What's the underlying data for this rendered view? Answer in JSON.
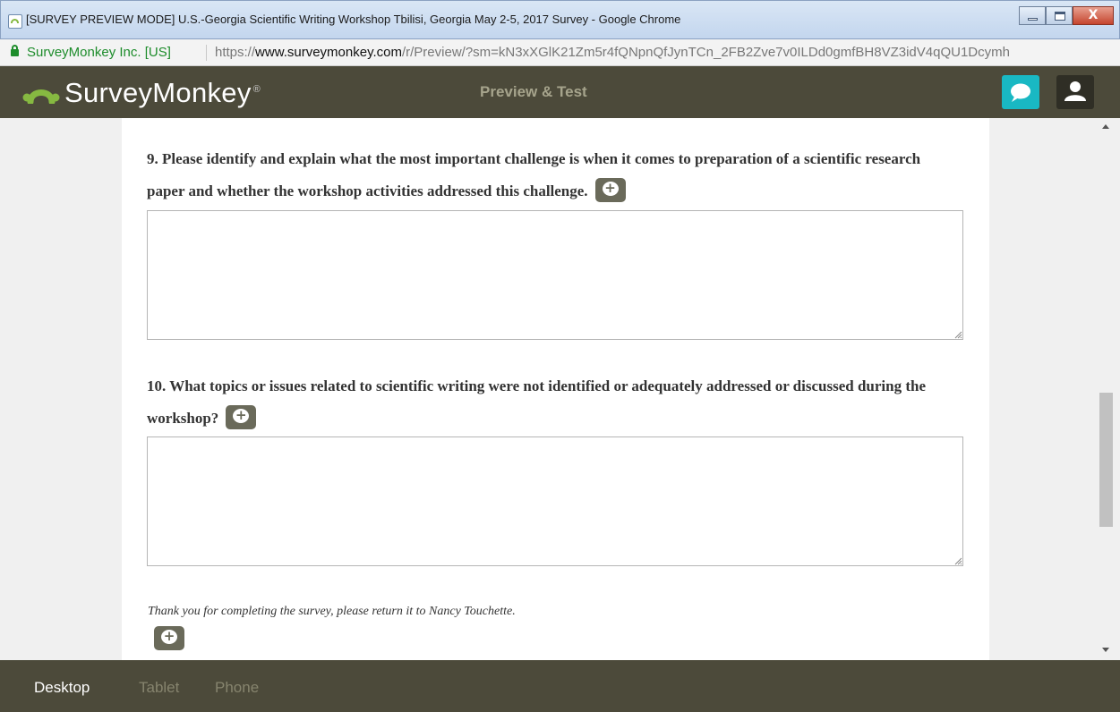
{
  "window": {
    "title": "[SURVEY PREVIEW MODE] U.S.-Georgia Scientific Writing Workshop Tbilisi, Georgia May 2-5, 2017 Survey - Google Chrome",
    "close_glyph": "X"
  },
  "address_bar": {
    "organization": "SurveyMonkey Inc. [US]",
    "url_scheme": "https://",
    "url_host": "www.surveymonkey.com",
    "url_path": "/r/Preview/?sm=kN3xXGlK21Zm5r4fQNpnQfJynTCn_2FB2Zve7v0ILDd0gmfBH8VZ3idV4qQU1Dcymh"
  },
  "header": {
    "logo_text": "SurveyMonkey",
    "logo_mark": "®",
    "title": "Preview & Test",
    "icons": [
      "chat-icon",
      "user-icon"
    ],
    "accent_color": "#19b8c3",
    "bar_color": "#4c4a3a"
  },
  "survey": {
    "questions": [
      {
        "text": "9. Please identify and explain what the most important challenge is when it comes to preparation of a scientific research paper and whether the workshop activities addressed this challenge.",
        "answer": ""
      },
      {
        "text": "10. What topics or issues related to scientific writing were not identified or adequately addressed or discussed during the workshop?",
        "answer": ""
      }
    ],
    "closing_text": "Thank you for completing the survey, please return it to Nancy Touchette."
  },
  "footer": {
    "tabs": [
      "Desktop",
      "Tablet",
      "Phone"
    ],
    "active_tab": "Desktop"
  }
}
